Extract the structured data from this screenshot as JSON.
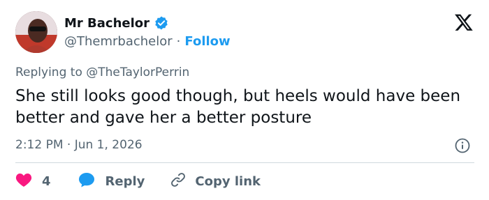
{
  "author": {
    "name": "Mr Bachelor",
    "handle": "@Themrbachelor",
    "separator": "·",
    "follow_label": "Follow"
  },
  "reply": {
    "prefix": "Replying to",
    "mention": "@TheTaylorPerrin"
  },
  "tweet": {
    "text": "She still looks good though, but heels would have been better and gave her a better posture",
    "time": "2:12 PM",
    "meta_separator": "·",
    "date": "Jun 1, 2026"
  },
  "actions": {
    "like_count": "4",
    "reply_label": "Reply",
    "copy_label": "Copy link"
  },
  "colors": {
    "accent": "#1d9bf0",
    "like": "#f91880",
    "text": "#0f1419",
    "muted": "#536471"
  },
  "icons": [
    "verified-badge-icon",
    "x-logo-icon",
    "info-icon",
    "heart-icon",
    "reply-bubble-icon",
    "link-icon"
  ]
}
